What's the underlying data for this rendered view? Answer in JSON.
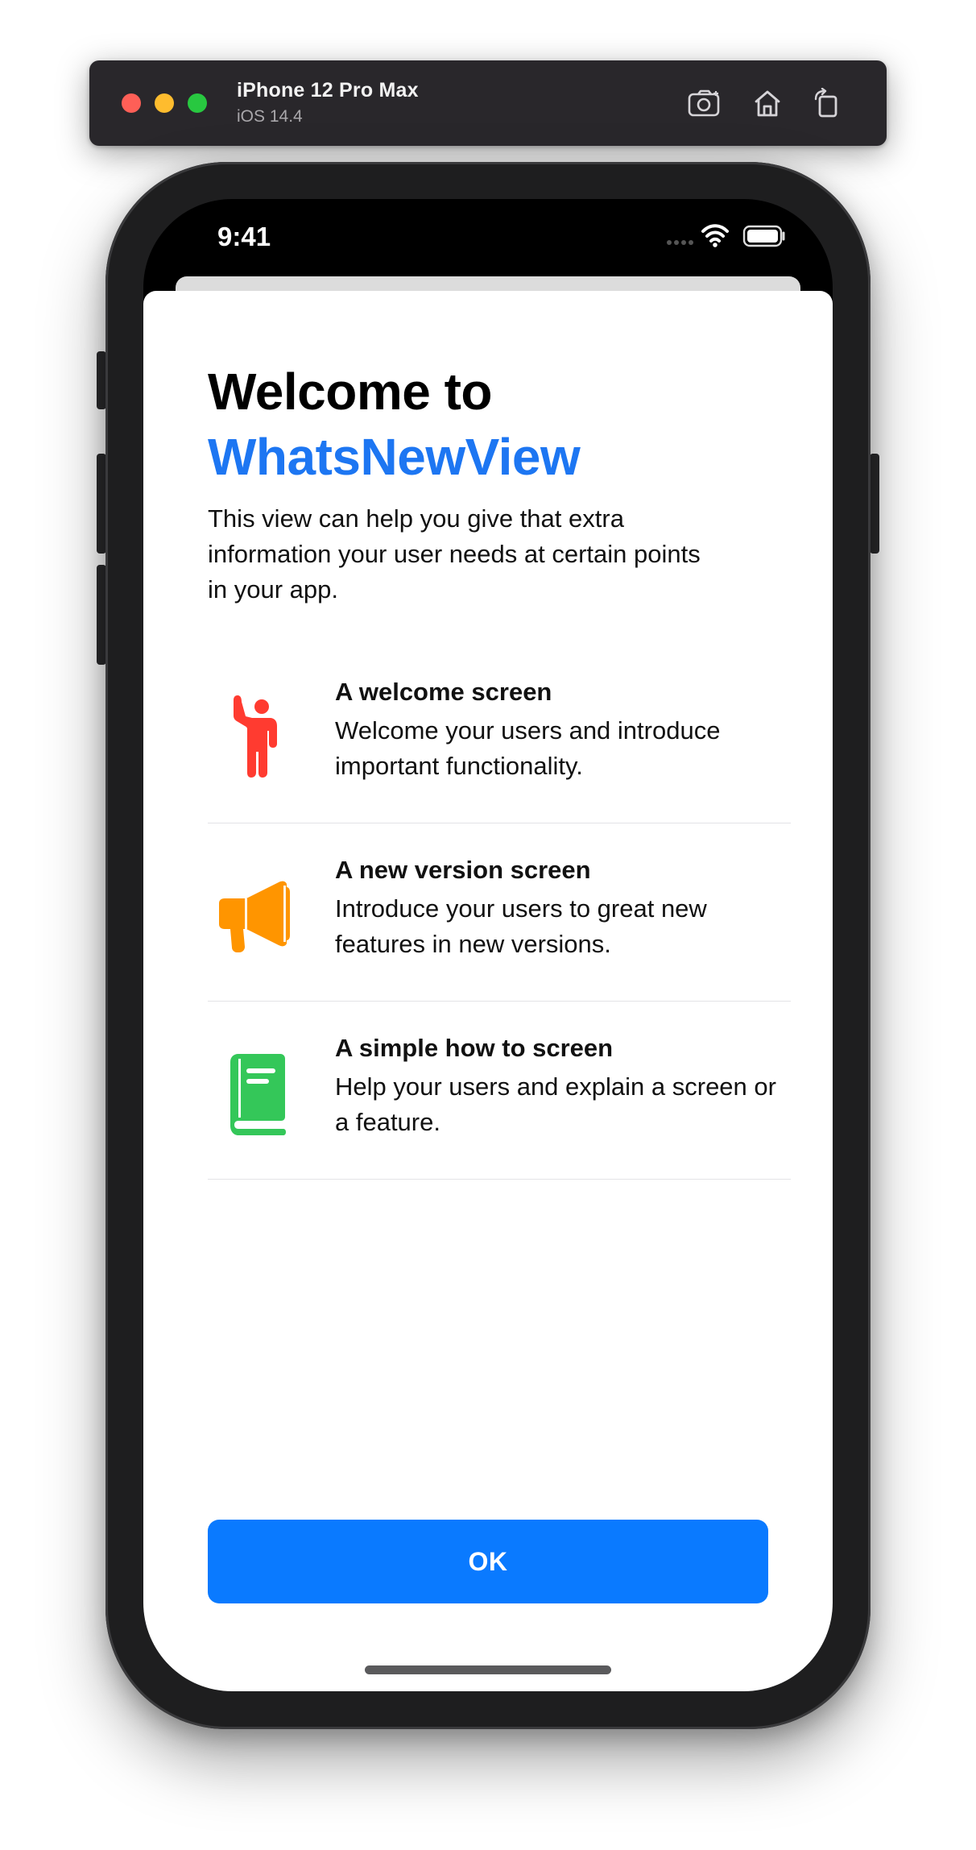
{
  "simulator": {
    "device_name": "iPhone 12 Pro Max",
    "os_version": "iOS 14.4",
    "toolbar_icons": [
      "screenshot-icon",
      "home-icon",
      "rotate-icon"
    ]
  },
  "status_bar": {
    "time": "9:41",
    "icons": [
      "signal-icon",
      "wifi-icon",
      "battery-icon"
    ]
  },
  "welcome": {
    "title_line1": "Welcome to",
    "title_line2": "WhatsNewView",
    "title_accent_color": "#1d76f2",
    "intro": "This view can help you give that extra information your user needs at certain points in your app."
  },
  "features": [
    {
      "icon": "figure-wave-icon",
      "icon_color": "#ff3b30",
      "title": "A welcome screen",
      "description": "Welcome your users and introduce important functionality."
    },
    {
      "icon": "megaphone-icon",
      "icon_color": "#ff9500",
      "title": "A new version screen",
      "description": "Introduce your users to great new features in new versions."
    },
    {
      "icon": "book-icon",
      "icon_color": "#34c759",
      "title": "A simple how to screen",
      "description": "Help your users and explain a screen or a feature."
    }
  ],
  "ok_button": {
    "label": "OK",
    "color": "#0a7aff"
  }
}
